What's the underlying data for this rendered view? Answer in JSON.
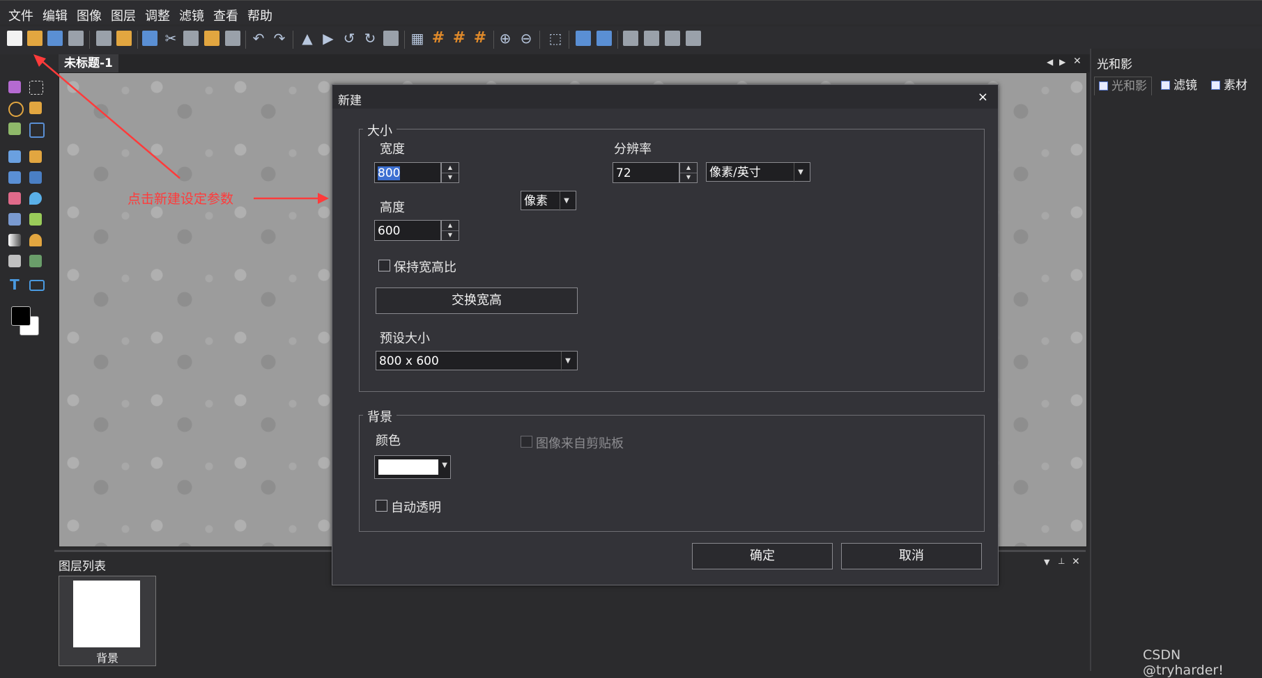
{
  "menu": [
    "文件",
    "编辑",
    "图像",
    "图层",
    "调整",
    "滤镜",
    "查看",
    "帮助"
  ],
  "toolbar": {
    "icons": [
      "new-document-icon",
      "open-folder-icon",
      "save-icon",
      "save-as-icon",
      "print-icon",
      "email-icon",
      "copy-icon",
      "cut-icon",
      "paste-icon",
      "paste-new-icon",
      "clear-icon",
      "undo-icon",
      "redo-icon",
      "flip-vertical-icon",
      "flip-horizontal-icon",
      "rotate-left-icon",
      "rotate-right-icon",
      "free-transform-icon",
      "grid-icon",
      "grid-orange-1-icon",
      "grid-orange-2-icon",
      "grid-orange-3-icon",
      "zoom-in-icon",
      "zoom-out-icon",
      "select-pointer-icon",
      "fit-screen-icon",
      "actual-size-icon",
      "align-left-icon",
      "align-top-icon",
      "align-right-icon",
      "align-bottom-icon"
    ]
  },
  "document": {
    "tab_title": "未标题-1"
  },
  "annotation": {
    "text": "点击新建设定参数",
    "color": "#ff3b3b"
  },
  "layers": {
    "title": "图层列表",
    "items": [
      {
        "name": "背景"
      }
    ]
  },
  "right_panel": {
    "title": "光和影",
    "tabs": [
      "光和影",
      "滤镜",
      "素材"
    ]
  },
  "dialog": {
    "title": "新建",
    "close_label": "×",
    "size_group": {
      "legend": "大小",
      "width_label": "宽度",
      "width_value": "800",
      "height_label": "高度",
      "height_value": "600",
      "unit_value": "像素",
      "resolution_label": "分辨率",
      "resolution_value": "72",
      "resolution_unit_value": "像素/英寸",
      "keep_ratio_label": "保持宽高比",
      "swap_button_label": "交换宽高",
      "preset_label": "预设大小",
      "preset_value": "800 x 600"
    },
    "background_group": {
      "legend": "背景",
      "color_label": "颜色",
      "color_value": "#ffffff",
      "from_clipboard_label": "图像来自剪贴板",
      "auto_transparent_label": "自动透明"
    },
    "ok_label": "确定",
    "cancel_label": "取消"
  },
  "watermark": "CSDN @tryharder!"
}
